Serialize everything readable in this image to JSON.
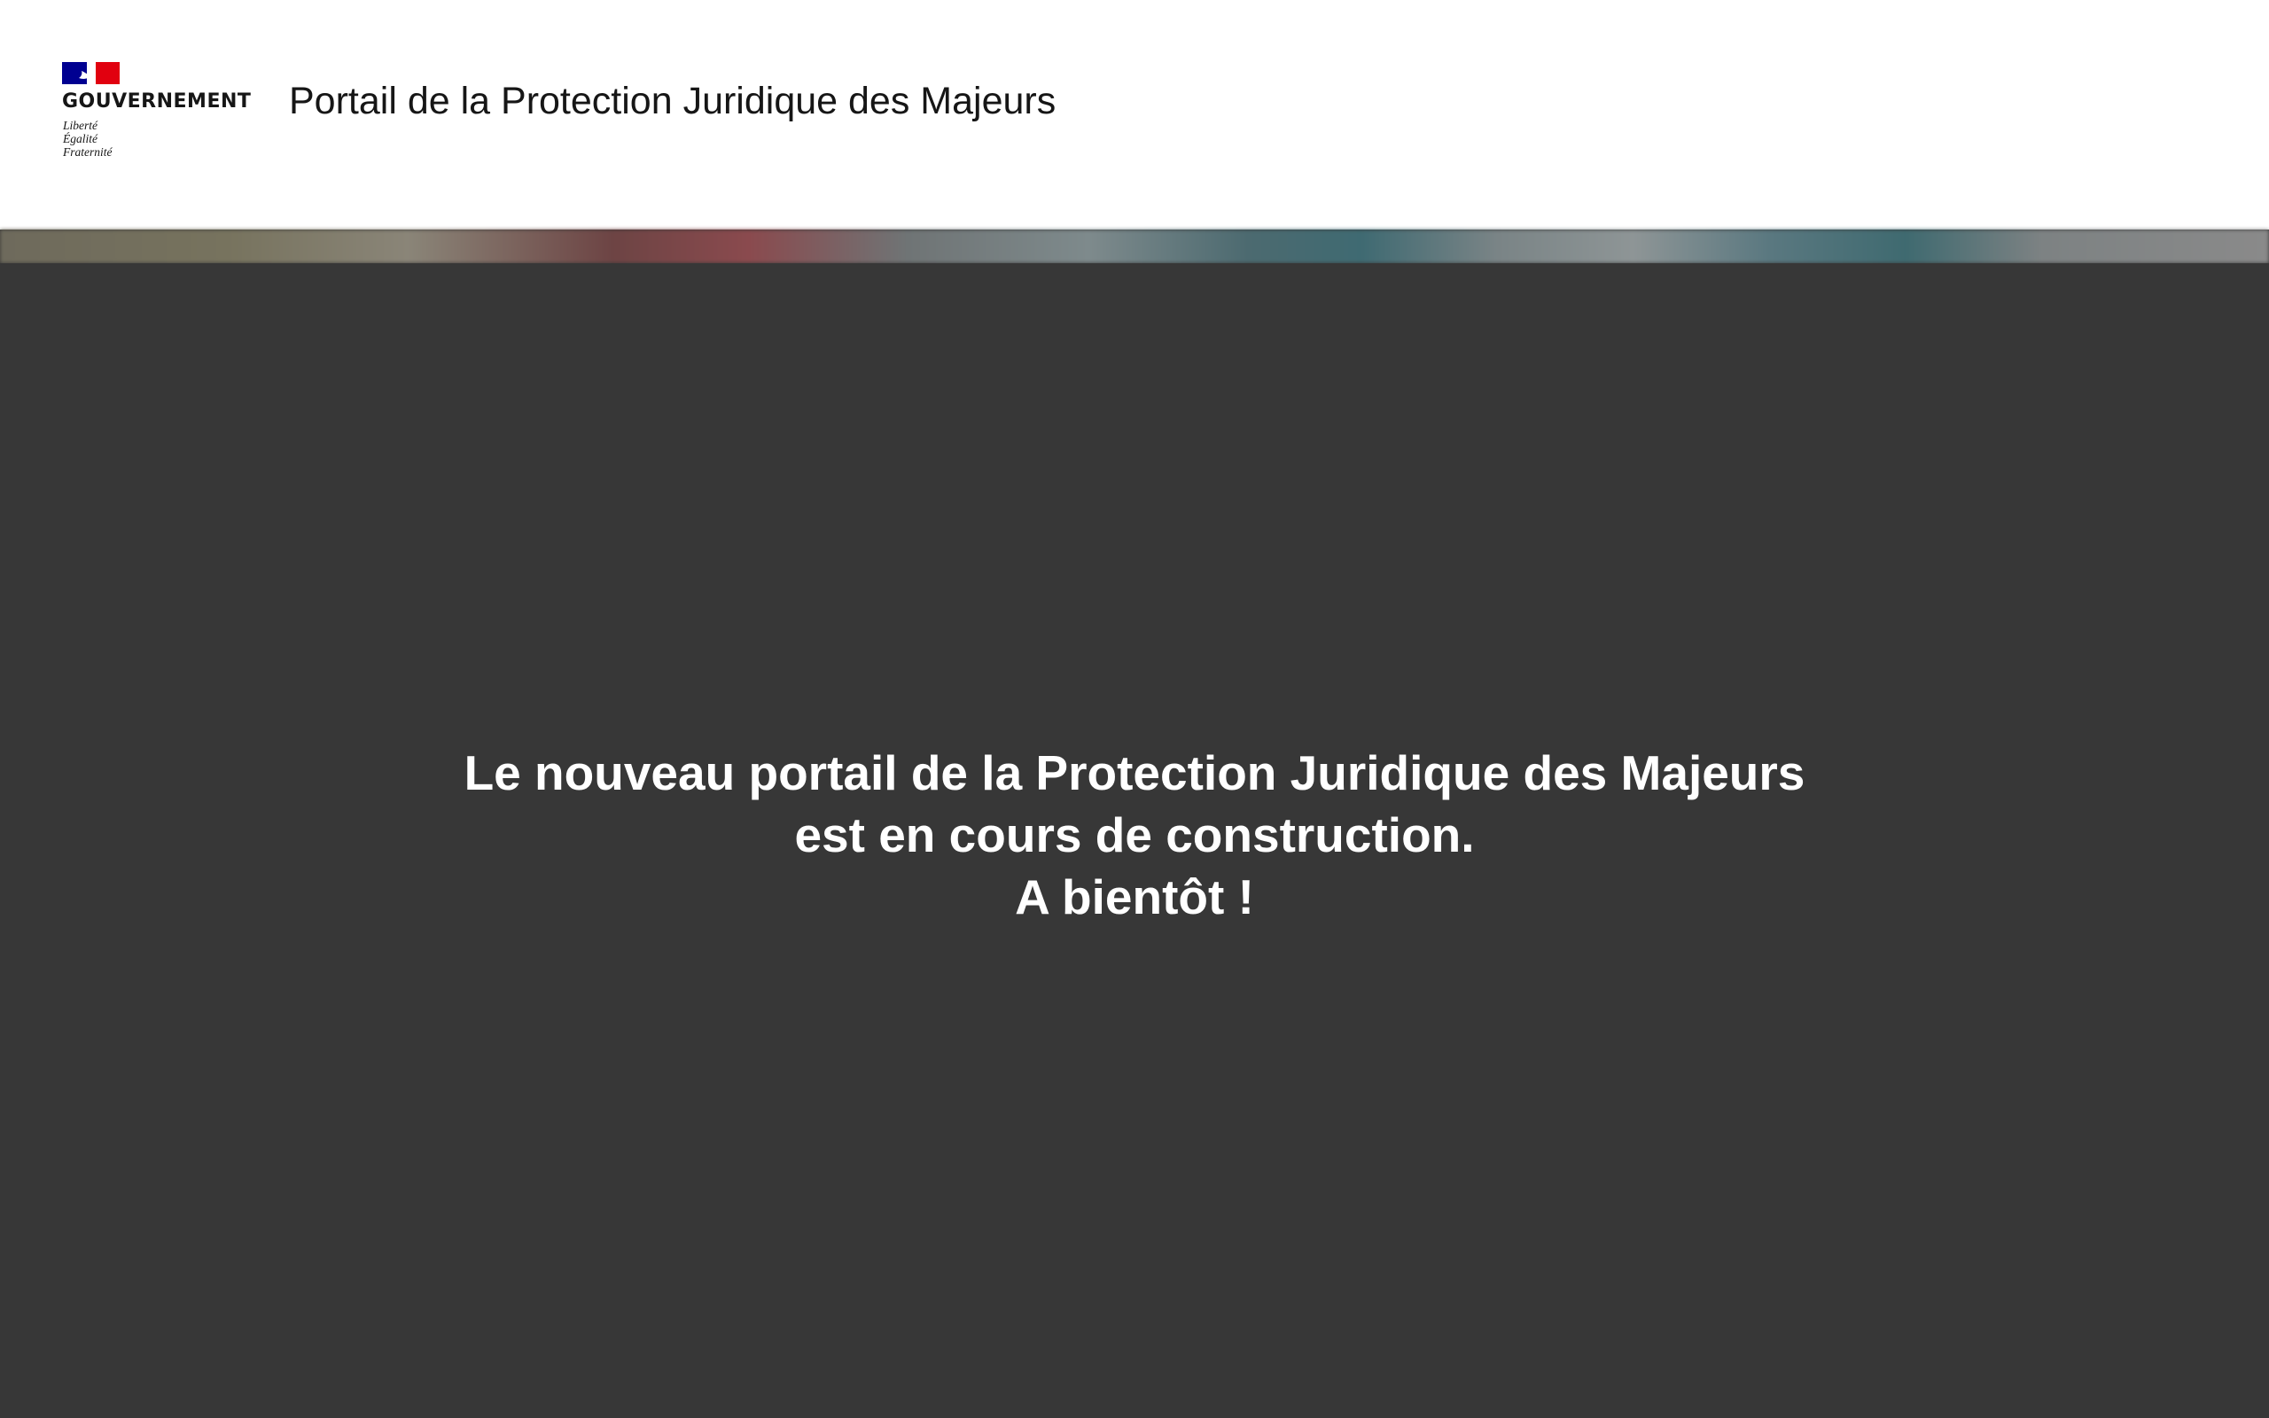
{
  "header": {
    "logo": {
      "name": "GOUVERNEMENT",
      "motto": [
        "Liberté",
        "Égalité",
        "Fraternité"
      ],
      "flag_colors": {
        "blue": "#000091",
        "white": "#ffffff",
        "red": "#e1000f"
      }
    },
    "site_title": "Portail de la Protection Juridique des Majeurs"
  },
  "main": {
    "message_lines": [
      "Le nouveau portail de la Protection Juridique des Majeurs",
      "est en cours de construction.",
      "A bientôt !"
    ],
    "background_color": "#373737"
  }
}
